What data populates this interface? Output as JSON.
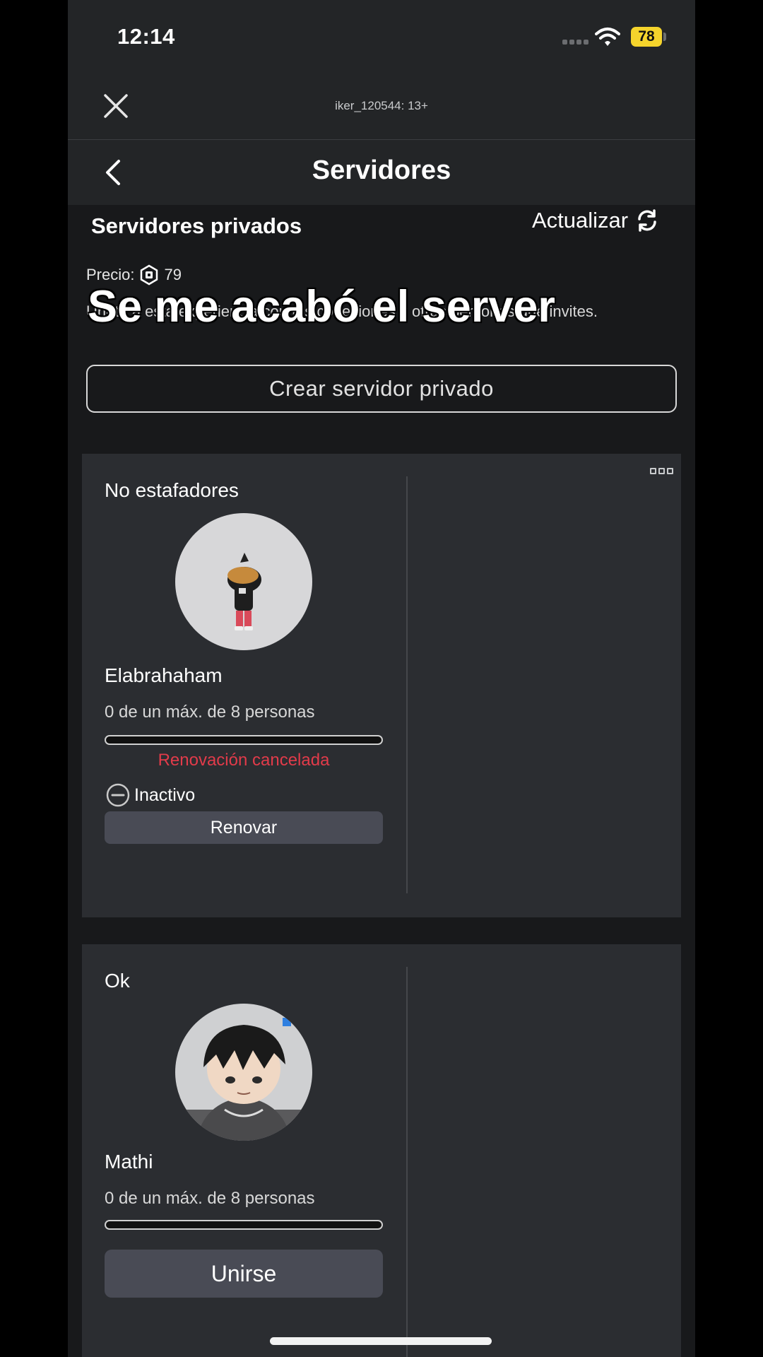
{
  "status_bar": {
    "time": "12:14",
    "battery": "78"
  },
  "header": {
    "account_label": "iker_120544: 13+",
    "title": "Servidores"
  },
  "section": {
    "title": "Servidores privados",
    "refresh_label": "Actualizar",
    "price_label": "Precio:",
    "price_value": "79",
    "description": "Únete a esta experiencia con tus conexiones y otras personas que invites.",
    "overlay_caption": "Se me acabó el server",
    "create_button": "Crear servidor privado"
  },
  "servers": [
    {
      "name": "No estafadores",
      "owner": "Elabrahaham",
      "capacity": "0 de un máx. de 8 personas",
      "renewal_status": "Renovación cancelada",
      "state": "Inactivo",
      "action": "Renovar"
    },
    {
      "name": "Ok",
      "owner": "Mathi",
      "capacity": "0 de un máx. de 8 personas",
      "action": "Unirse"
    }
  ]
}
